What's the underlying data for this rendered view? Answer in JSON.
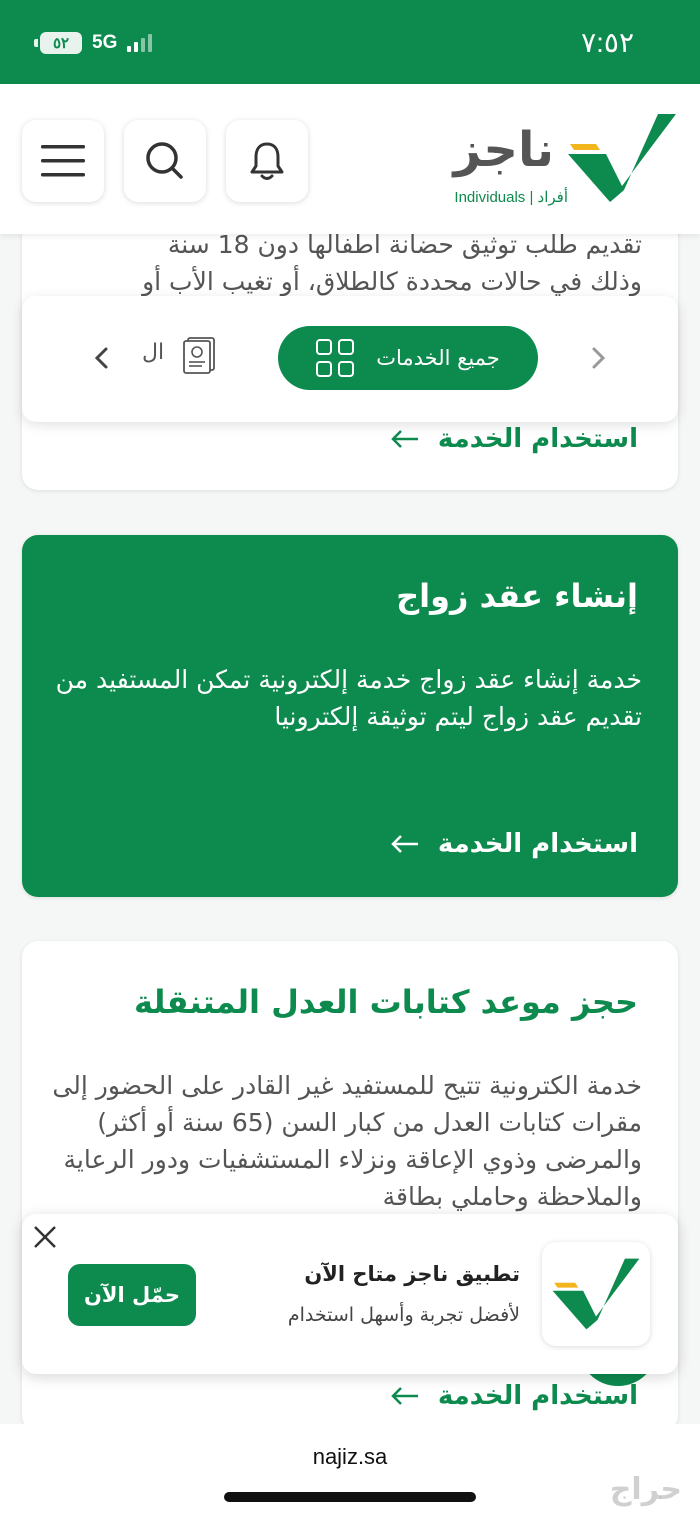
{
  "status_bar": {
    "time": "٧:٥٢",
    "battery": "٥٢",
    "network": "5G"
  },
  "header": {
    "logo_text": "ناجز",
    "logo_subtitle": "Individuals | أفراد",
    "icons": [
      "bell-icon",
      "search-icon",
      "menu-icon"
    ]
  },
  "card_partial": {
    "desc_line1": "تقديم طلب توثيق حضانة أطفالها دون 18 سنة",
    "desc_line2": "وذلك في حالات محددة كالطلاق، أو تغيب الأب أو",
    "link": "استخدام الخدمة"
  },
  "service_nav": {
    "all_services": "جميع الخدمات",
    "prev_label": "ال"
  },
  "card_marriage": {
    "title": "إنشاء عقد زواج",
    "desc": "خدمة إنشاء عقد زواج خدمة إلكترونية تمكن المستفيد من تقديم عقد زواج ليتم توثيقة إلكترونيا",
    "link": "استخدام الخدمة"
  },
  "card_mobile": {
    "title": "حجز موعد كتابات العدل المتنقلة",
    "desc": "خدمة الكترونية تتيح للمستفيد غير القادر على الحضور إلى مقرات كتابات العدل من كبار السن (65 سنة أو أكثر) والمرضى وذوي الإعاقة ونزلاء المستشفيات ودور الرعاية والملاحظة وحاملي بطاقة",
    "link": "استخدام الخدمة"
  },
  "app_banner": {
    "title": "تطبيق ناجز متاح الآن",
    "subtitle": "لأفضل تجربة وأسهل استخدام",
    "button": "حمّل الآن"
  },
  "browser": {
    "url": "najiz.sa"
  },
  "watermark": "حراج",
  "colors": {
    "brand_green": "#0d8a4e",
    "logo_yellow": "#f2b51c"
  }
}
